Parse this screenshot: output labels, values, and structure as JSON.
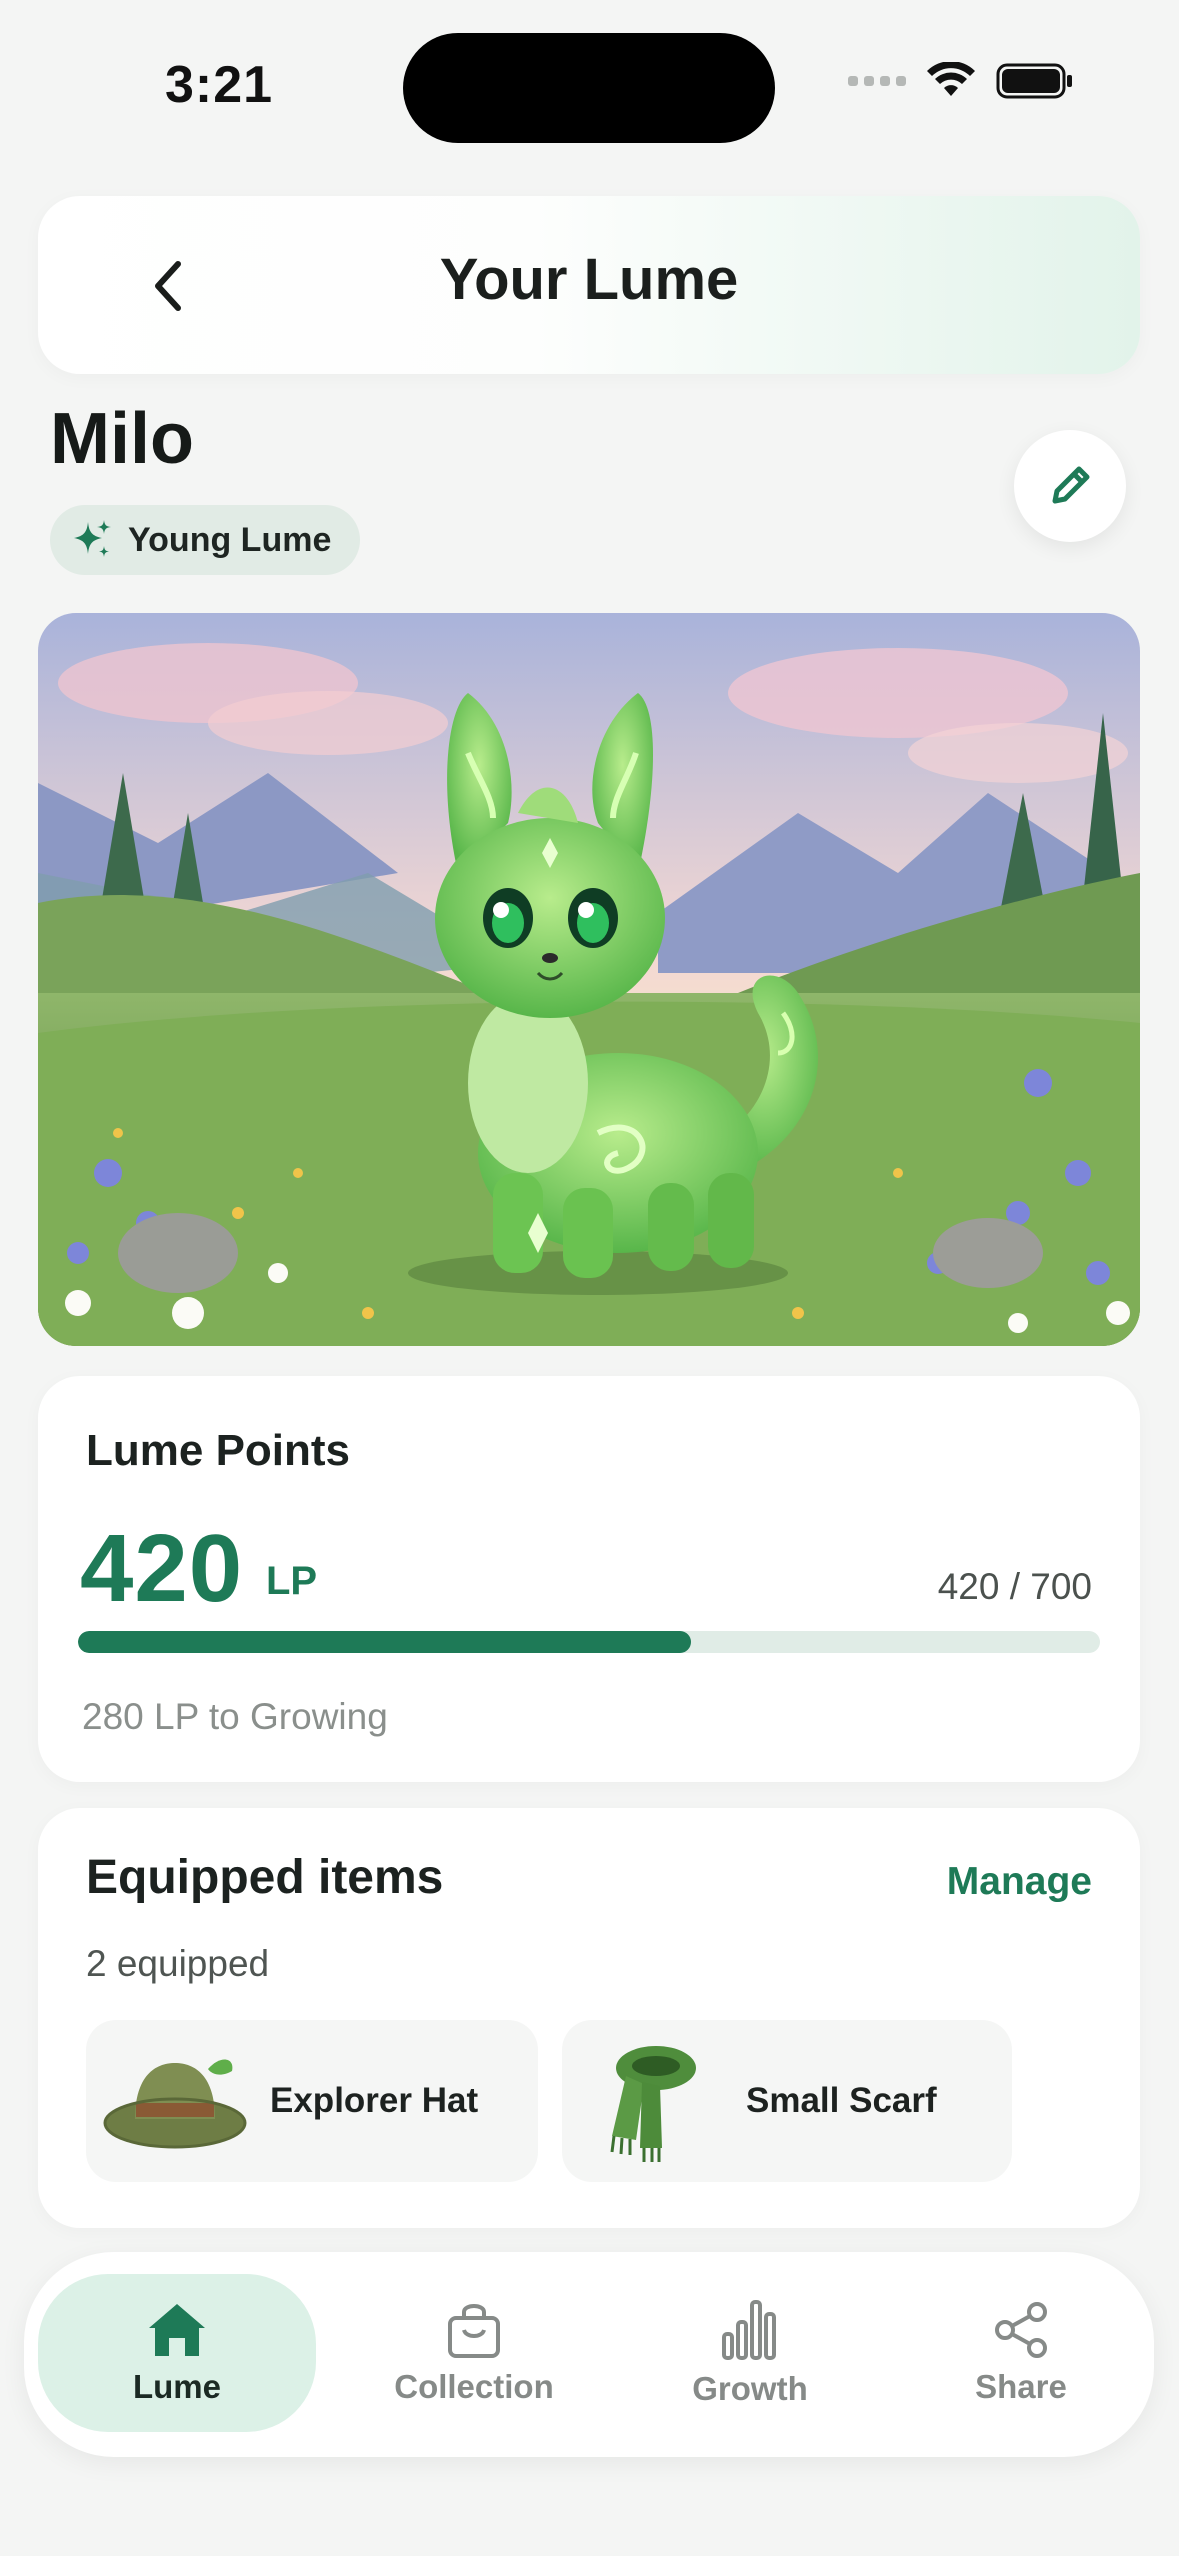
{
  "status_bar": {
    "time": "3:21"
  },
  "header": {
    "title": "Your Lume"
  },
  "pet": {
    "name": "Milo",
    "stage": "Young Lume"
  },
  "points": {
    "title": "Lume Points",
    "value": "420",
    "unit": "LP",
    "ratio": "420 / 700",
    "progress": 0.6,
    "hint": "280 LP to Growing"
  },
  "equipped": {
    "title": "Equipped items",
    "manage_label": "Manage",
    "count_text": "2 equipped",
    "items": [
      {
        "label": "Explorer Hat",
        "icon": "explorer-hat-icon"
      },
      {
        "label": "Small Scarf",
        "icon": "scarf-icon"
      }
    ]
  },
  "nav": {
    "items": [
      {
        "label": "Lume",
        "icon": "home-icon",
        "active": true
      },
      {
        "label": "Collection",
        "icon": "bag-icon"
      },
      {
        "label": "Growth",
        "icon": "bar-chart-icon"
      },
      {
        "label": "Share",
        "icon": "share-icon"
      }
    ]
  },
  "colors": {
    "accent": "#1e7a57",
    "accent_light": "#dcf1e7",
    "background": "#f4f5f4"
  }
}
